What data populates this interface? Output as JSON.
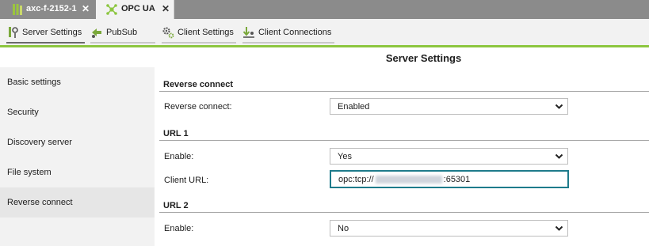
{
  "tabs": [
    {
      "label": "axc-f-2152-1",
      "icon": "plc-device-icon"
    },
    {
      "label": "OPC UA",
      "icon": "opc-network-icon"
    }
  ],
  "toolbar": {
    "server_settings": "Server Settings",
    "pubsub": "PubSub",
    "client_settings": "Client Settings",
    "client_connections": "Client Connections"
  },
  "sidebar": {
    "items": [
      {
        "label": "Basic settings"
      },
      {
        "label": "Security"
      },
      {
        "label": "Discovery server"
      },
      {
        "label": "File system"
      },
      {
        "label": "Reverse connect"
      }
    ]
  },
  "main": {
    "title": "Server Settings",
    "reverse_connect": {
      "heading": "Reverse connect",
      "label": "Reverse connect:",
      "value": "Enabled"
    },
    "url1": {
      "heading": "URL 1",
      "enable_label": "Enable:",
      "enable_value": "Yes",
      "client_url_label": "Client URL:",
      "client_url_prefix": "opc:tcp://",
      "client_url_suffix": ":65301"
    },
    "url2": {
      "heading": "URL 2",
      "enable_label": "Enable:",
      "enable_value": "No"
    }
  },
  "colors": {
    "accent_green": "#8cc63f",
    "focus_teal": "#1e7b8b",
    "tabbar_gray": "#8b8b8b"
  }
}
